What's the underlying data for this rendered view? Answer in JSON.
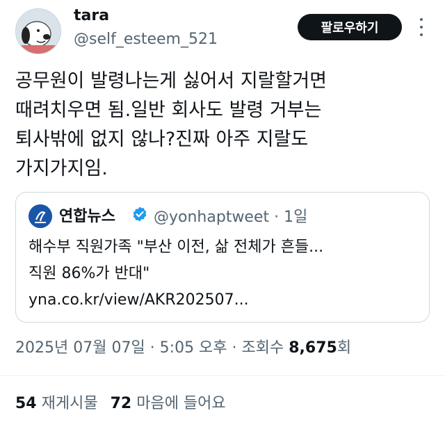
{
  "user": {
    "name": "tara",
    "handle": "@self_esteem_521",
    "follow_label": "팔로우하기"
  },
  "tweet": {
    "lines": [
      "공무원이 발령나는게 싫어서 지랄할거면",
      "때려치우면 됨.일반 회사도 발령 거부는",
      "퇴사밖에 없지 않나?진짜 아주 지랄도",
      "가지가지임."
    ]
  },
  "quote": {
    "name": "연합뉴스",
    "handle": "@yonhaptweet · 1일",
    "lines": [
      "해수부 직원가족 \"부산 이전, 삶 전체가 흔들...",
      "직원 86%가 반대\"",
      "yna.co.kr/view/AKR202507..."
    ]
  },
  "meta": {
    "timestamp": "2025년 07월 07일 · 5:05 오후 · 조회수 ",
    "views": "8,675",
    "views_suffix": "회"
  },
  "stats": {
    "reposts_count": "54",
    "reposts_label": "재게시물",
    "likes_count": "72",
    "likes_label": "마음에 들어요"
  },
  "colors": {
    "text": "#0f1419",
    "secondary": "#536471",
    "verified": "#1d9bf0",
    "follow_bg": "#0f1419",
    "border": "#cfd9de"
  }
}
